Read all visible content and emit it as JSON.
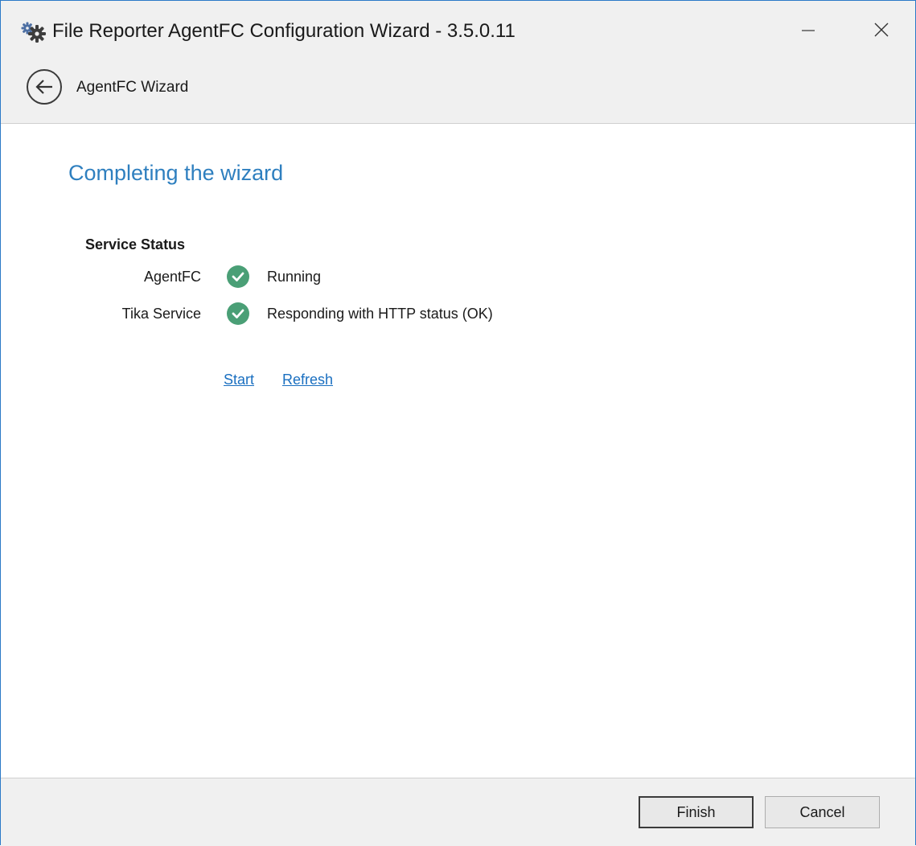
{
  "window": {
    "title": "File Reporter AgentFC Configuration Wizard - 3.5.0.11",
    "app_icon": "gears-icon",
    "minimize_icon": "minimize-icon",
    "close_icon": "close-icon"
  },
  "nav": {
    "back_icon": "back-arrow-icon",
    "title": "AgentFC Wizard"
  },
  "main": {
    "heading": "Completing the wizard",
    "service_status": {
      "title": "Service Status",
      "rows": [
        {
          "label": "AgentFC",
          "status": "Running",
          "icon": "check-circle-icon"
        },
        {
          "label": "Tika Service",
          "status": "Responding with HTTP status (OK)",
          "icon": "check-circle-icon"
        }
      ]
    },
    "links": {
      "start": "Start",
      "refresh": "Refresh"
    }
  },
  "footer": {
    "finish_label": "Finish",
    "cancel_label": "Cancel"
  },
  "colors": {
    "accent": "#2e7fbf",
    "link": "#1a6fc0",
    "status_ok": "#4a9f76",
    "chrome_bg": "#f0f0f0",
    "window_border": "#2b79c7"
  }
}
